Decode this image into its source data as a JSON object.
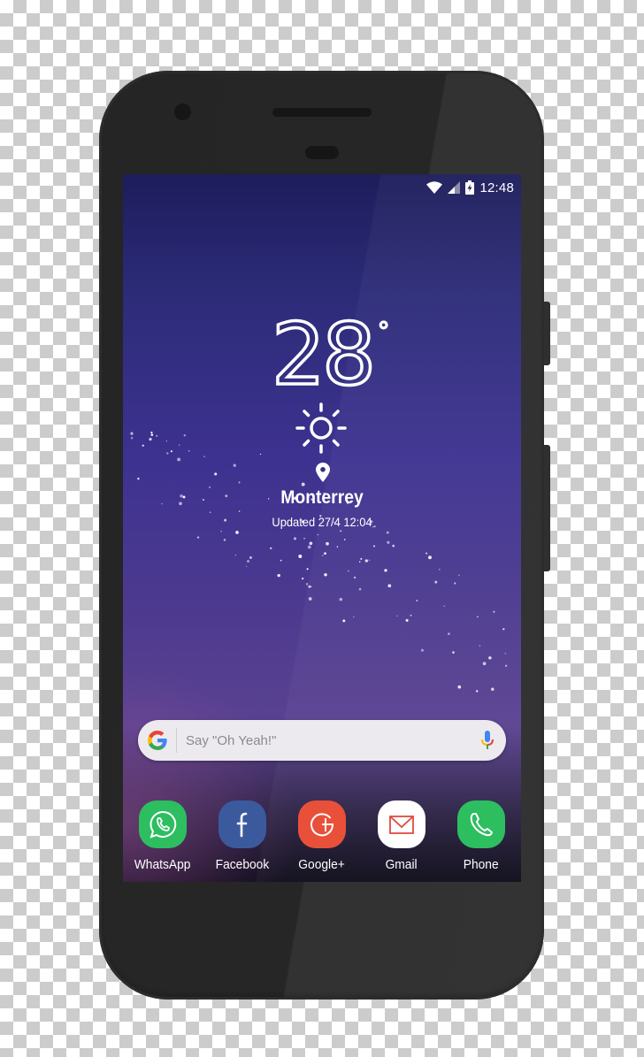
{
  "status_bar": {
    "time": "12:48",
    "icons": [
      "wifi-icon",
      "cell-signal-icon",
      "battery-charging-icon"
    ]
  },
  "weather": {
    "temperature": "28",
    "unit_symbol": "°",
    "condition_icon": "sun-icon",
    "location_icon": "location-pin-icon",
    "city": "Monterrey",
    "updated": "Updated 27/4  12:04"
  },
  "search": {
    "logo_icon": "google-g-icon",
    "placeholder": "Say \"Oh Yeah!\"",
    "value": "",
    "mic_icon": "microphone-icon"
  },
  "dock": {
    "apps": [
      {
        "label": "WhatsApp",
        "icon": "whatsapp-icon",
        "color": "#2dbe60"
      },
      {
        "label": "Facebook",
        "icon": "facebook-icon",
        "color": "#3b5a9e"
      },
      {
        "label": "Google+",
        "icon": "google-plus-icon",
        "color": "#e9503a"
      },
      {
        "label": "Gmail",
        "icon": "gmail-icon",
        "color": "#ffffff"
      },
      {
        "label": "Phone",
        "icon": "phone-icon",
        "color": "#2dbe60"
      }
    ]
  },
  "colors": {
    "phone_body": "#262626",
    "wallpaper_top": "#1d1d5c",
    "wallpaper_mid": "#4d3a8f",
    "search_bar": "#eceaee",
    "gmail_red": "#e04a3f"
  }
}
